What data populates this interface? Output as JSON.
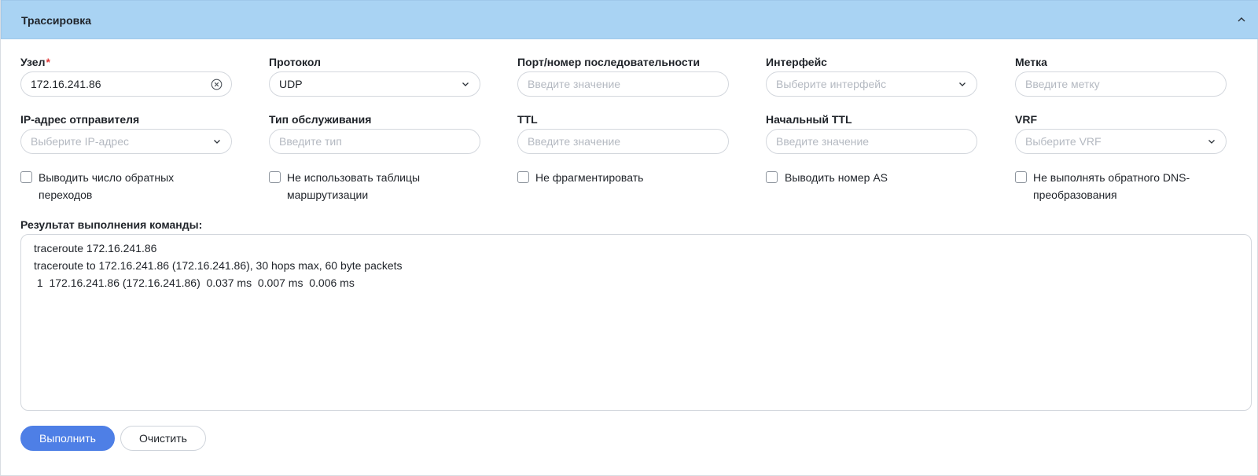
{
  "panel": {
    "title": "Трассировка"
  },
  "fields": {
    "node": {
      "label": "Узел",
      "required_mark": "*",
      "value": "172.16.241.86"
    },
    "protocol": {
      "label": "Протокол",
      "value": "UDP"
    },
    "port": {
      "label": "Порт/номер последовательности",
      "placeholder": "Введите значение"
    },
    "interface": {
      "label": "Интерфейс",
      "placeholder": "Выберите интерфейс"
    },
    "mark": {
      "label": "Метка",
      "placeholder": "Введите метку"
    },
    "source_ip": {
      "label": "IP-адрес отправителя",
      "placeholder": "Выберите IP-адрес"
    },
    "service_type": {
      "label": "Тип обслуживания",
      "placeholder": "Введите тип"
    },
    "ttl": {
      "label": "TTL",
      "placeholder": "Введите значение"
    },
    "initial_ttl": {
      "label": "Начальный TTL",
      "placeholder": "Введите значение"
    },
    "vrf": {
      "label": "VRF",
      "placeholder": "Выберите VRF"
    }
  },
  "checkboxes": [
    {
      "line1": "Выводить число обратных",
      "line2": "переходов",
      "checked": false
    },
    {
      "line1": "Не использовать таблицы",
      "line2": "маршрутизации",
      "checked": false
    },
    {
      "line1": "Не фрагментировать",
      "line2": "",
      "checked": false
    },
    {
      "line1": "Выводить номер AS",
      "line2": "",
      "checked": false
    },
    {
      "line1": "Не выполнять обратного DNS-",
      "line2": "преобразования",
      "checked": false
    }
  ],
  "result": {
    "label": "Результат выполнения команды:",
    "lines": [
      "traceroute 172.16.241.86",
      "traceroute to 172.16.241.86 (172.16.241.86), 30 hops max, 60 byte packets",
      " 1  172.16.241.86 (172.16.241.86)  0.037 ms  0.007 ms  0.006 ms"
    ]
  },
  "actions": {
    "run_label": "Выполнить",
    "clear_label": "Очистить"
  },
  "colors": {
    "header_bg": "#a9d3f3",
    "primary": "#4e7fe6",
    "required": "#e03b3b"
  },
  "icons": {
    "collapse": "chevron-up-icon",
    "clear": "clear-circle-icon",
    "dropdown": "chevron-down-icon"
  }
}
